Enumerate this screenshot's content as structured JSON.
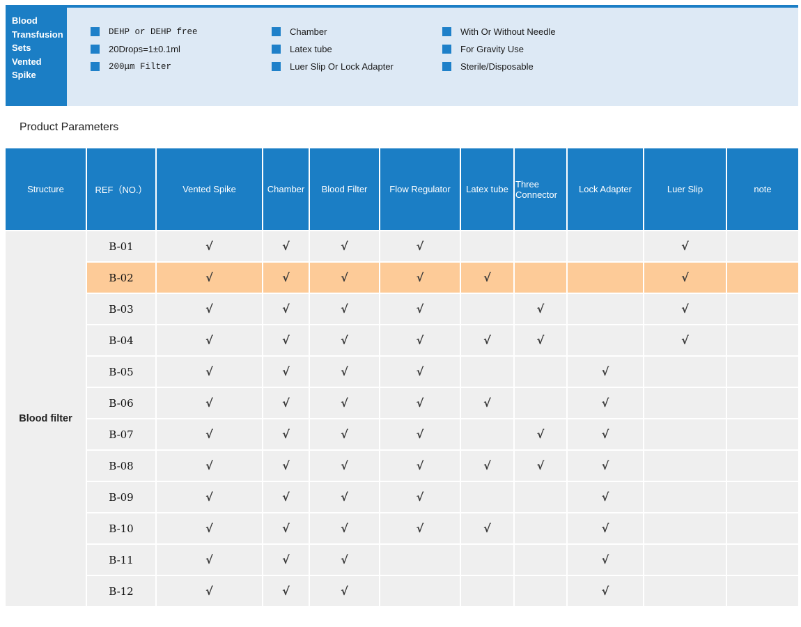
{
  "colors": {
    "brand_blue": "#1b7ec5",
    "panel_light_blue": "#dde9f5",
    "row_gray": "#efefef",
    "highlight_orange": "#fdcb98"
  },
  "banner": {
    "title_lines": [
      "Blood",
      "Transfusion",
      "Sets",
      "Vented",
      "Spike"
    ],
    "feature_columns": [
      [
        {
          "text": "DEHP or DEHP free",
          "font": "mono"
        },
        {
          "text": "20Drops=1±0.1ml",
          "font": "sans"
        },
        {
          "text": "200μm Filter",
          "font": "mono"
        }
      ],
      [
        {
          "text": "Chamber",
          "font": "sans"
        },
        {
          "text": "Latex tube",
          "font": "sans"
        },
        {
          "text": "Luer Slip Or Lock Adapter",
          "font": "sans"
        }
      ],
      [
        {
          "text": "With Or Without Needle",
          "font": "sans"
        },
        {
          "text": "For Gravity Use",
          "font": "sans"
        },
        {
          "text": "Sterile/Disposable",
          "font": "sans"
        }
      ]
    ]
  },
  "section_title": "Product Parameters",
  "table": {
    "columns": [
      "Structure",
      "REF（NO.）",
      "Vented Spike",
      "Chamber",
      "Blood Filter",
      "Flow Regulator",
      "Latex tube",
      "Three Connector",
      "Lock Adapter",
      "Luer Slip",
      "note"
    ],
    "structure_label": "Blood filter",
    "check_mark": "√",
    "rows": [
      {
        "ref": "B-01",
        "checks": [
          1,
          1,
          1,
          1,
          0,
          0,
          0,
          1,
          0
        ],
        "highlight": false
      },
      {
        "ref": "B-02",
        "checks": [
          1,
          1,
          1,
          1,
          1,
          0,
          0,
          1,
          0
        ],
        "highlight": true
      },
      {
        "ref": "B-03",
        "checks": [
          1,
          1,
          1,
          1,
          0,
          1,
          0,
          1,
          0
        ],
        "highlight": false
      },
      {
        "ref": "B-04",
        "checks": [
          1,
          1,
          1,
          1,
          1,
          1,
          0,
          1,
          0
        ],
        "highlight": false
      },
      {
        "ref": "B-05",
        "checks": [
          1,
          1,
          1,
          1,
          0,
          0,
          1,
          0,
          0
        ],
        "highlight": false
      },
      {
        "ref": "B-06",
        "checks": [
          1,
          1,
          1,
          1,
          1,
          0,
          1,
          0,
          0
        ],
        "highlight": false
      },
      {
        "ref": "B-07",
        "checks": [
          1,
          1,
          1,
          1,
          0,
          1,
          1,
          0,
          0
        ],
        "highlight": false
      },
      {
        "ref": "B-08",
        "checks": [
          1,
          1,
          1,
          1,
          1,
          1,
          1,
          0,
          0
        ],
        "highlight": false
      },
      {
        "ref": "B-09",
        "checks": [
          1,
          1,
          1,
          1,
          0,
          0,
          1,
          0,
          0
        ],
        "highlight": false
      },
      {
        "ref": "B-10",
        "checks": [
          1,
          1,
          1,
          1,
          1,
          0,
          1,
          0,
          0
        ],
        "highlight": false
      },
      {
        "ref": "B-11",
        "checks": [
          1,
          1,
          1,
          0,
          0,
          0,
          1,
          0,
          0
        ],
        "highlight": false
      },
      {
        "ref": "B-12",
        "checks": [
          1,
          1,
          1,
          0,
          0,
          0,
          1,
          0,
          0
        ],
        "highlight": false
      }
    ]
  }
}
